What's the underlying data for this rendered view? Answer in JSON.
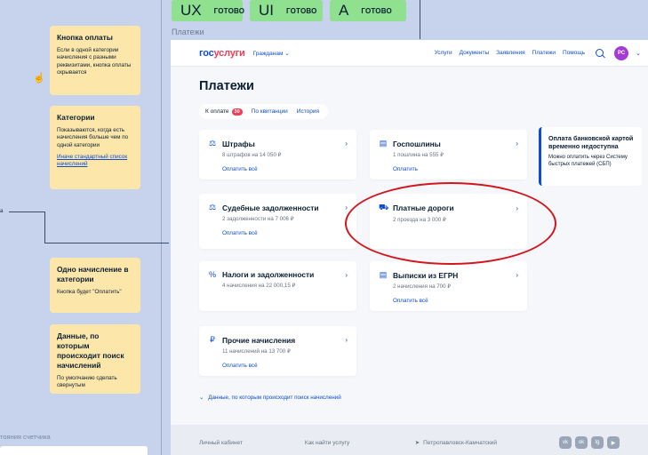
{
  "status_chips": [
    {
      "code": "UX",
      "status": "ГОТОВО"
    },
    {
      "code": "UI",
      "status": "ГОТОВО"
    },
    {
      "code": "A",
      "status": "ГОТОВО"
    }
  ],
  "frame_label": "Платежи",
  "notes": [
    {
      "title": "Кнопка оплаты",
      "text": "Если в одной категории начисления с разными реквизитами, кнопка оплаты скрывается",
      "link": ""
    },
    {
      "title": "Категории",
      "text": "Показываются, когда есть начисления больше чем по одной категории",
      "link": "Иначе стандартный список начислений"
    },
    {
      "title": "Одно начисление в категории",
      "text": "Кнопка будет \"Оплатить\"",
      "link": ""
    },
    {
      "title": "Данные, по которым происходит поиск начислений",
      "text": "По умолчанию сделать свернутым",
      "link": ""
    }
  ],
  "left_edge_label": "а",
  "left_bottom_label": "тояния счетчика",
  "header": {
    "logo_part1": "гос",
    "logo_part2": "услуги",
    "audience": "Гражданам",
    "nav": [
      "Услуги",
      "Документы",
      "Заявления",
      "Платежи",
      "Помощь"
    ],
    "avatar_initials": "РС"
  },
  "page_title": "Платежи",
  "tabs": [
    {
      "label": "К оплате",
      "badge": "30"
    },
    {
      "label": "По квитанции",
      "badge": ""
    },
    {
      "label": "История",
      "badge": ""
    }
  ],
  "cards": [
    {
      "title": "Штрафы",
      "sub": "8 штрафов на 14 050 ₽",
      "action": "Оплатить всё",
      "icon": "police-icon"
    },
    {
      "title": "Госпошлины",
      "sub": "1 пошлина на 555 ₽",
      "action": "Оплатить",
      "icon": "document-icon"
    },
    {
      "title": "Судебные задолженности",
      "sub": "2 задолженности на 7 006 ₽",
      "action": "Оплатить всё",
      "icon": "scales-icon"
    },
    {
      "title": "Платные дороги",
      "sub": "2 проезда на 3 000 ₽",
      "action": "",
      "icon": "car-icon"
    },
    {
      "title": "Налоги и задолженности",
      "sub": "4 начисления на 22 000,15 ₽",
      "action": "",
      "icon": "percent-icon"
    },
    {
      "title": "Выписки из ЕГРН",
      "sub": "2 начисления на 700 ₽",
      "action": "Оплатить всё",
      "icon": "file-icon"
    },
    {
      "title": "Прочие начисления",
      "sub": "11 начислений на 13 700 ₽",
      "action": "Оплатить всё",
      "icon": "ruble-icon"
    }
  ],
  "notice": {
    "title": "Оплата банковской картой временно недоступна",
    "text": "Можно оплатить через Систему быстрых платежей (СБП)"
  },
  "expand_link": "Данные, по которым происходит поиск начислений",
  "footer": {
    "links": [
      "Личный кабинет",
      "Как найти услугу"
    ],
    "location": "Петропавловск-Камчатский",
    "socials": [
      "vk",
      "ok",
      "tg",
      "yt"
    ]
  },
  "colors": {
    "accent": "#0d4cd3",
    "highlight": "#d3161e",
    "note": "#fde6a9",
    "chip": "#8fe08f"
  }
}
